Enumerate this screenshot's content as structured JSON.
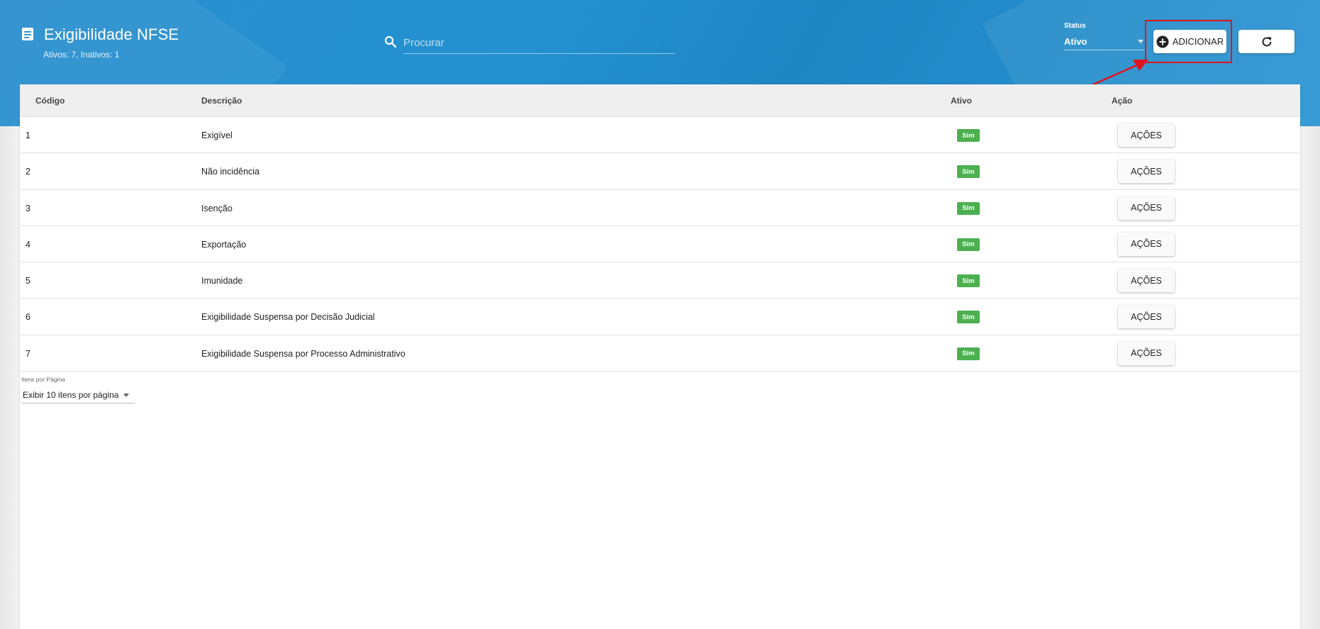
{
  "header": {
    "title": "Exigibilidade NFSE",
    "subtitle": "Ativos: 7, Inativos: 1",
    "title_icon": "document-icon"
  },
  "search": {
    "placeholder": "Procurar",
    "value": ""
  },
  "status_filter": {
    "label": "Status",
    "value": "Ativo"
  },
  "toolbar": {
    "add_label": "ADICIONAR",
    "refresh_icon": "refresh-icon"
  },
  "table": {
    "columns": [
      "Código",
      "Descrição",
      "Ativo",
      "Ação"
    ],
    "rows": [
      {
        "code": "1",
        "description": "Exigível",
        "active": "Sim",
        "action": "AÇÕES"
      },
      {
        "code": "2",
        "description": "Não incidência",
        "active": "Sim",
        "action": "AÇÕES"
      },
      {
        "code": "3",
        "description": "Isenção",
        "active": "Sim",
        "action": "AÇÕES"
      },
      {
        "code": "4",
        "description": "Exportação",
        "active": "Sim",
        "action": "AÇÕES"
      },
      {
        "code": "5",
        "description": "Imunidade",
        "active": "Sim",
        "action": "AÇÕES"
      },
      {
        "code": "6",
        "description": "Exigibilidade Suspensa por Decisão Judicial",
        "active": "Sim",
        "action": "AÇÕES"
      },
      {
        "code": "7",
        "description": "Exigibilidade Suspensa por Processo Administrativo",
        "active": "Sim",
        "action": "AÇÕES"
      }
    ]
  },
  "pagination": {
    "label": "Itens por Página",
    "value": "Exibir 10 itens por página"
  },
  "colors": {
    "header_blue": "#2390cf",
    "badge_green": "#4caf50",
    "highlight_red": "#e0141e"
  }
}
